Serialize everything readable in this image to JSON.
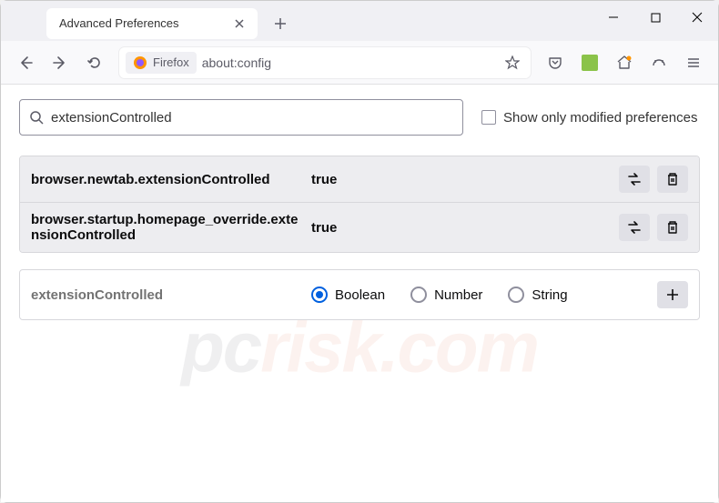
{
  "titlebar": {
    "tab_title": "Advanced Preferences"
  },
  "toolbar": {
    "identity_label": "Firefox",
    "url": "about:config"
  },
  "search": {
    "value": "extensionControlled",
    "checkbox_label": "Show only modified preferences"
  },
  "prefs": [
    {
      "name": "browser.newtab.extensionControlled",
      "value": "true"
    },
    {
      "name": "browser.startup.homepage_override.extensionControlled",
      "value": "true"
    }
  ],
  "new_pref": {
    "name": "extensionControlled",
    "types": [
      "Boolean",
      "Number",
      "String"
    ],
    "selected": "Boolean"
  },
  "watermark": {
    "p1": "pc",
    "p2": "risk.com"
  }
}
